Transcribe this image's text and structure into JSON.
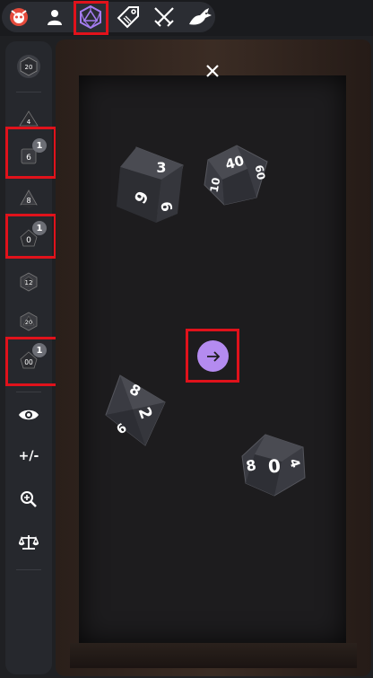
{
  "toolbar": {
    "tabs": [
      {
        "name": "app-logo-icon"
      },
      {
        "name": "character-icon"
      },
      {
        "name": "dice-icon",
        "active": true
      },
      {
        "name": "tag-icon"
      },
      {
        "name": "combat-swords-icon"
      },
      {
        "name": "dragon-icon"
      }
    ]
  },
  "sidebar": {
    "dice": [
      {
        "name": "d20-pool",
        "label": "20"
      },
      {
        "name": "d4",
        "label": "4"
      },
      {
        "name": "d6",
        "label": "6",
        "count": "1"
      },
      {
        "name": "d8",
        "label": "8"
      },
      {
        "name": "d10",
        "label": "0",
        "count": "1"
      },
      {
        "name": "d12",
        "label": "12"
      },
      {
        "name": "d20",
        "label": "20"
      },
      {
        "name": "d100",
        "label": "00",
        "count": "1"
      }
    ],
    "modifier_label": "+/-"
  },
  "tray": {
    "dice_results": [
      {
        "die": "d6",
        "faces": [
          "3",
          "6",
          "9"
        ]
      },
      {
        "die": "d10",
        "faces": [
          "40",
          "60",
          "10"
        ]
      },
      {
        "die": "d8",
        "faces": [
          "8",
          "2",
          "6"
        ]
      },
      {
        "die": "d10",
        "faces": [
          "8",
          "0",
          "4"
        ]
      }
    ]
  },
  "colors": {
    "accent": "#b48bf0",
    "highlight": "#e0121b",
    "background": "#1f2023",
    "sidebar": "#26282d"
  }
}
